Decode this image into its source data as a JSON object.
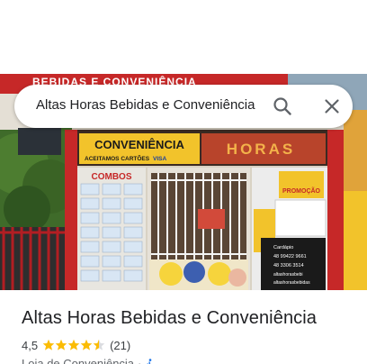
{
  "search": {
    "query": "Altas Horas Bebidas e Conveniência"
  },
  "place": {
    "title": "Altas Horas Bebidas e Conveniência",
    "rating": "4,5",
    "rating_value": 4.5,
    "stars_max": 5,
    "reviews": "(21)",
    "category": "Loja de Conveniência",
    "separator": "·"
  },
  "storefront": {
    "top_sign": "BEBIDAS E CONVENIÊNCIA",
    "sign_main": "CONVENIÊNCIA",
    "sign_sub": "ACEITAMOS CARTÕES",
    "sign_visa": "VISA",
    "brand_sign": "HORAS",
    "combos": "COMBOS",
    "promo_top": "PROMOÇÃO",
    "cardapio": "Cardápio",
    "phone1": "48 99422 9661",
    "phone2": "48 3306 3514",
    "handle1": "altashorasbebi",
    "handle2": "altashorasbebidas"
  },
  "colors": {
    "accent_star": "#fbbc04",
    "storefront_red": "#c62828",
    "sign_yellow": "#f2c32b",
    "icon_grey": "#5f6368",
    "accessibility_blue": "#1a73e8"
  },
  "icons": {
    "search": "search-icon",
    "close": "close-icon",
    "star": "star-icon",
    "accessibility": "wheelchair-icon"
  }
}
